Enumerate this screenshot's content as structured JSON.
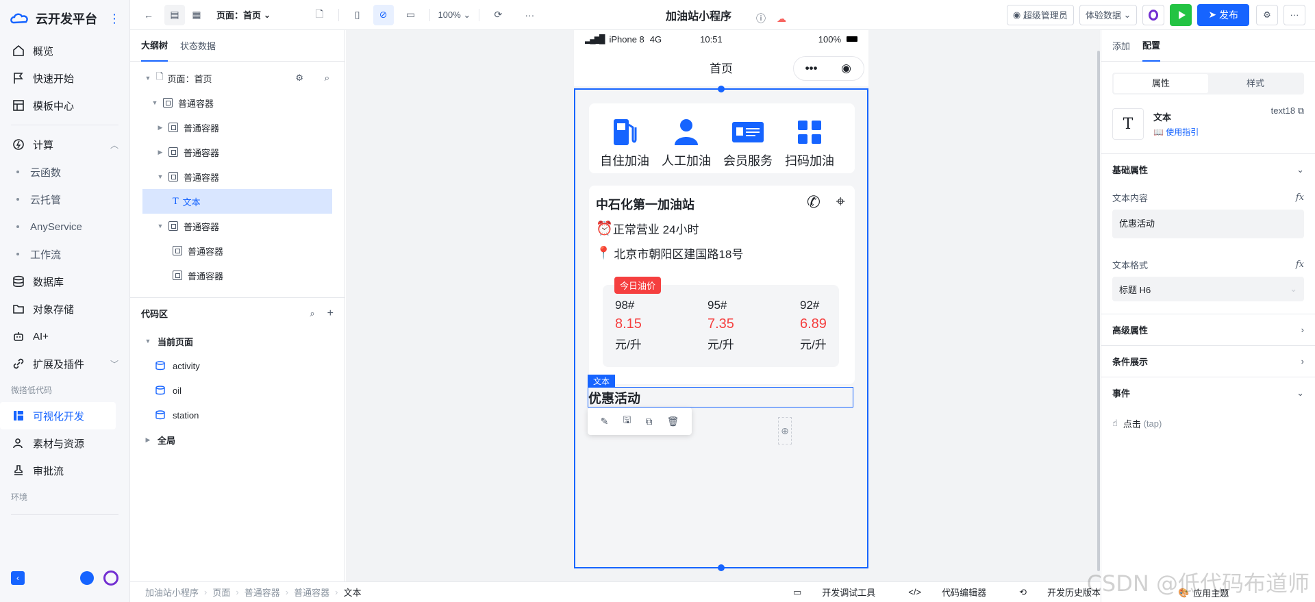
{
  "brand": {
    "title": "云开发平台",
    "more": "⋮"
  },
  "nav": {
    "items": [
      {
        "label": "概览"
      },
      {
        "label": "快速开始"
      },
      {
        "label": "模板中心"
      }
    ],
    "compute": {
      "label": "计算",
      "subs": [
        "云函数",
        "云托管",
        "AnyService",
        "工作流"
      ]
    },
    "items2": [
      {
        "label": "数据库"
      },
      {
        "label": "对象存储"
      },
      {
        "label": "AI+"
      },
      {
        "label": "扩展及插件"
      }
    ],
    "section_lowcode": "微搭低代码",
    "items3": [
      {
        "label": "可视化开发"
      },
      {
        "label": "素材与资源"
      },
      {
        "label": "审批流"
      }
    ],
    "section_env": "环境"
  },
  "toolbar": {
    "page_label": "页面：首页",
    "zoom": "100%",
    "app_title": "加油站小程序",
    "user": "超级管理员",
    "data_mode": "体验数据",
    "publish": "发布"
  },
  "outline": {
    "tabs": [
      "大纲树",
      "状态数据"
    ],
    "page_node": "页面：首页",
    "nodes": [
      "普通容器",
      "普通容器",
      "普通容器",
      "普通容器",
      "文本",
      "普通容器",
      "普通容器",
      "普通容器"
    ],
    "code_title": "代码区",
    "current_page": "当前页面",
    "code_items": [
      "activity",
      "oil",
      "station"
    ],
    "global": "全局"
  },
  "phone": {
    "carrier": "iPhone 8",
    "network": "4G",
    "time": "10:51",
    "battery": "100%",
    "nav_title": "首页",
    "services": [
      "自住加油",
      "人工加油",
      "会员服务",
      "扫码加油"
    ],
    "station_name": "中石化第一加油站",
    "hours": "正常营业 24小时",
    "address": "北京市朝阳区建国路18号",
    "badge": "今日油价",
    "prices": [
      {
        "grade": "98#",
        "price": "8.15",
        "unit": "元/升"
      },
      {
        "grade": "95#",
        "price": "7.35",
        "unit": "元/升"
      },
      {
        "grade": "92#",
        "price": "6.89",
        "unit": "元/升"
      }
    ],
    "text_tag": "文本",
    "selected_text": "优惠活动"
  },
  "props": {
    "tabs": [
      "添加",
      "配置"
    ],
    "seg": [
      "属性",
      "样式"
    ],
    "comp_name": "文本",
    "comp_id": "text18",
    "guide": "使用指引",
    "basic": "基础属性",
    "text_content_label": "文本内容",
    "text_content_value": "优惠活动",
    "text_format_label": "文本格式",
    "text_format_value": "标题 H6",
    "advanced": "高级属性",
    "condition": "条件展示",
    "events": "事件",
    "event_click": "点击",
    "event_tap": "(tap)"
  },
  "bottombar": {
    "crumbs": [
      "加油站小程序",
      "页面",
      "普通容器",
      "普通容器",
      "文本"
    ],
    "tools": [
      "开发调试工具",
      "代码编辑器",
      "开发历史版本",
      "应用主题"
    ]
  },
  "watermark": "CSDN @低代码布道师"
}
